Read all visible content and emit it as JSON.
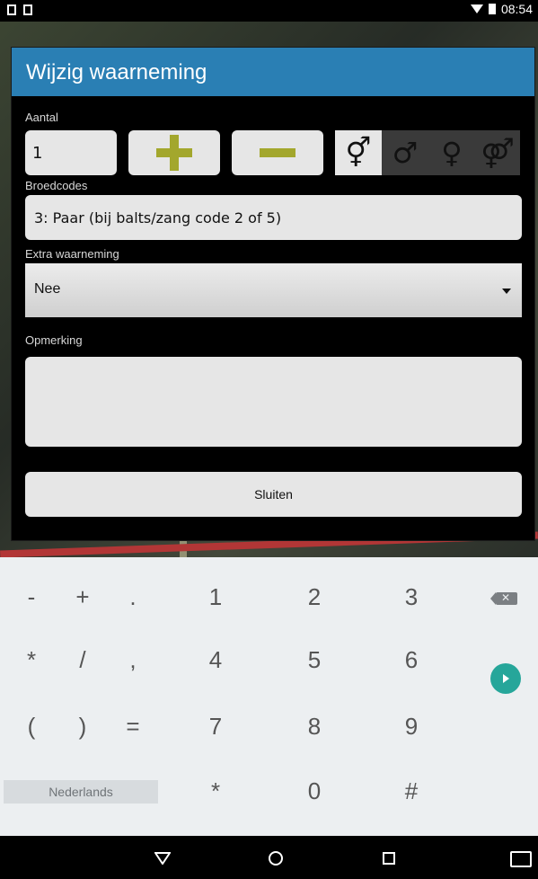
{
  "status_bar": {
    "time": "08:54"
  },
  "dialog": {
    "title": "Wijzig waarneming",
    "aantal_label": "Aantal",
    "aantal_value": "1",
    "broedcodes_label": "Broedcodes",
    "broedcodes_value": "3: Paar (bij balts/zang code 2 of 5)",
    "extra_label": "Extra waarneming",
    "extra_value": "Nee",
    "opmerking_label": "Opmerking",
    "close_label": "Sluiten"
  },
  "keyboard": {
    "row1": [
      "-",
      "+",
      ".",
      "1",
      "2",
      "3"
    ],
    "row2": [
      "*",
      "/",
      ",",
      "4",
      "5",
      "6"
    ],
    "row3": [
      "(",
      ")",
      "=",
      "7",
      "8",
      "9"
    ],
    "row4": [
      "*",
      "0",
      "#"
    ],
    "language": "Nederlands"
  },
  "gender_symbols": [
    "⚥",
    "♂",
    "♀",
    "⚤"
  ]
}
